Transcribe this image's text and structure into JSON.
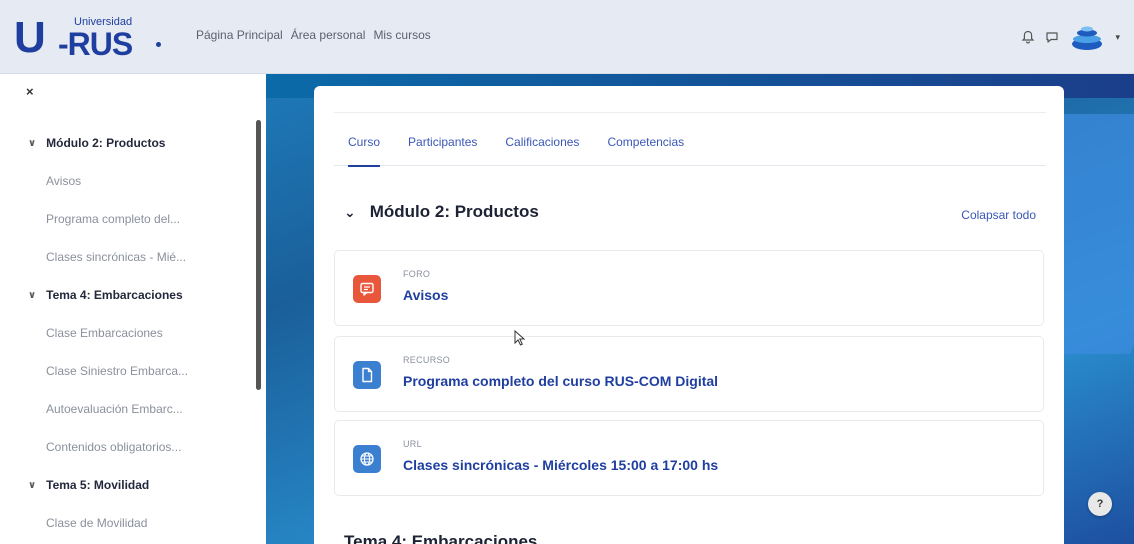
{
  "brand": {
    "logo_top": "Universidad",
    "logo_main": "U",
    "logo_sub": "-RUS"
  },
  "nav": {
    "links": [
      "Página Principal",
      "Área personal",
      "Mis cursos"
    ]
  },
  "sidebar": {
    "close": "×",
    "items": [
      {
        "type": "section",
        "label": "Módulo 2: Productos"
      },
      {
        "type": "item",
        "label": "Avisos"
      },
      {
        "type": "item",
        "label": "Programa completo del..."
      },
      {
        "type": "item",
        "label": "Clases sincrónicas - Mié..."
      },
      {
        "type": "section",
        "label": "Tema 4: Embarcaciones"
      },
      {
        "type": "item",
        "label": "Clase Embarcaciones"
      },
      {
        "type": "item",
        "label": "Clase Siniestro Embarca..."
      },
      {
        "type": "item",
        "label": "Autoevaluación Embarc..."
      },
      {
        "type": "item",
        "label": "Contenidos obligatorios..."
      },
      {
        "type": "section",
        "label": "Tema 5: Movilidad"
      },
      {
        "type": "item",
        "label": "Clase de Movilidad"
      }
    ]
  },
  "main": {
    "tabs": [
      {
        "label": "Curso",
        "active": true
      },
      {
        "label": "Participantes",
        "active": false
      },
      {
        "label": "Calificaciones",
        "active": false
      },
      {
        "label": "Competencias",
        "active": false
      }
    ],
    "module_title": "Módulo 2: Productos",
    "collapse_all": "Colapsar todo",
    "activities": [
      {
        "type": "FORO",
        "name": "Avisos",
        "color": "#e8573b",
        "icon": "forum-icon"
      },
      {
        "type": "RECURSO",
        "name": "Programa completo del curso RUS-COM Digital",
        "color": "#3b7fd1",
        "icon": "file-icon"
      },
      {
        "type": "URL",
        "name": "Clases sincrónicas - Miércoles 15:00 a 17:00 hs",
        "color": "#3b7fd1",
        "icon": "globe-icon"
      }
    ],
    "next_section": "Tema 4: Embarcaciones"
  },
  "help": "?"
}
